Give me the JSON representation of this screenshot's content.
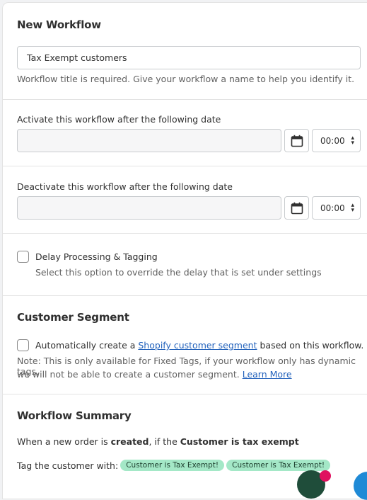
{
  "workflow": {
    "heading": "New Workflow",
    "title_value": "Tax Exempt customers",
    "title_help": "Workflow title is required. Give your workflow a name to help you identify it."
  },
  "activate": {
    "label": "Activate this workflow after the following date",
    "date_value": "",
    "time_value": "00:00"
  },
  "deactivate": {
    "label": "Deactivate this workflow after the following date",
    "date_value": "",
    "time_value": "00:00"
  },
  "delay": {
    "checked": false,
    "label": "Delay Processing & Tagging",
    "help": "Select this option to override the delay that is set under settings"
  },
  "segment": {
    "heading": "Customer Segment",
    "checked": false,
    "label_before": "Automatically create a ",
    "label_link": "Shopify customer segment",
    "label_after": " based on this workflow.",
    "note_line1": "Note: This is only available for Fixed Tags, if your workflow only has dynamic tags,",
    "note_line2": "we will not be able to create a customer segment. ",
    "learn_more": "Learn More"
  },
  "summary": {
    "heading": "Workflow Summary",
    "when_prefix": "When a new order is ",
    "when_event": "created",
    "when_mid": ", if the ",
    "when_condition": "Customer is tax exempt",
    "tag_prefix": "Tag the customer with:",
    "tags": [
      "Customer is Tax Exempt!",
      "Customer is Tax Exempt!"
    ]
  },
  "colors": {
    "tag_bg": "#a4e8c7",
    "link": "#2463bc",
    "card_bg": "#ffffff",
    "page_bg": "#f1f2f4"
  },
  "icons": {
    "date_picker": "calendar-icon",
    "time_select": "select-chevron-icon"
  }
}
